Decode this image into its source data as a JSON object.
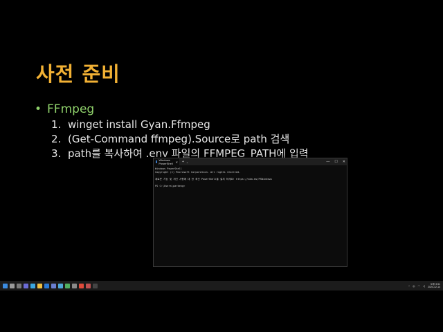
{
  "slide": {
    "title": "사전 준비",
    "bullet": "FFmpeg",
    "steps": [
      {
        "num": "1.",
        "text": "winget install Gyan.Ffmpeg"
      },
      {
        "num": "2.",
        "text": "(Get-Command ffmpeg).Source로 path 검색"
      },
      {
        "num": "3.",
        "text": "path를 복사하여 .env 파일의 FFMPEG_PATH에 입력"
      }
    ]
  },
  "terminal": {
    "tab_title": "Windows PowerShell",
    "lines": [
      "Windows PowerShell",
      "Copyright (C) Microsoft Corporation. All rights reserved.",
      "",
      "새로운 기능 및 개선 사항에 대 한 최신 PowerShell을 설치 하세요! https://aka.ms/PSWindows",
      "",
      "PS C:\\Users\\parkeng>"
    ]
  },
  "taskbar": {
    "icons": [
      {
        "name": "start-icon",
        "color": "#3b8be0"
      },
      {
        "name": "search-icon",
        "color": "#9a9a9a"
      },
      {
        "name": "task-view-icon",
        "color": "#7a7a7a"
      },
      {
        "name": "chat-icon",
        "color": "#6b6bd6"
      },
      {
        "name": "edge-icon",
        "color": "#3aa6e0"
      },
      {
        "name": "file-explorer-icon",
        "color": "#f0c040"
      },
      {
        "name": "vscode-icon",
        "color": "#2a7ad6"
      },
      {
        "name": "app-icon-1",
        "color": "#6a7fd0"
      },
      {
        "name": "app-icon-2",
        "color": "#4fa7d8"
      },
      {
        "name": "app-icon-3",
        "color": "#50b060"
      },
      {
        "name": "app-icon-4",
        "color": "#8a8a8a"
      },
      {
        "name": "chrome-icon",
        "color": "#e04a3a"
      },
      {
        "name": "app-icon-5",
        "color": "#c05050"
      },
      {
        "name": "terminal-icon",
        "color": "#444444"
      }
    ],
    "clock_time": "오후 3:51",
    "clock_date": "2024-12-14"
  }
}
